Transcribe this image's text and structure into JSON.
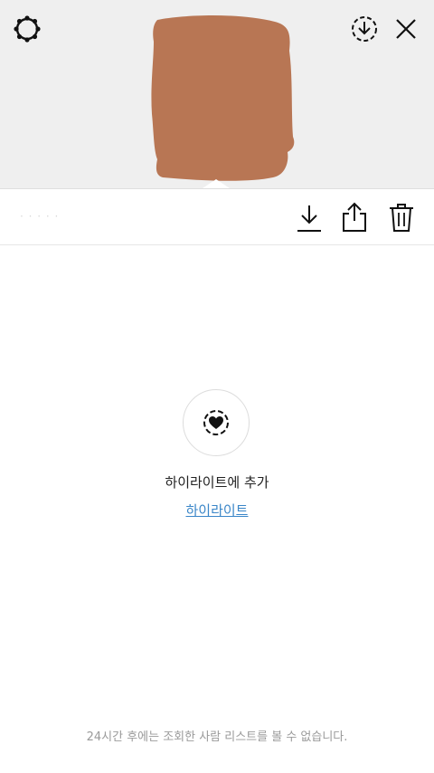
{
  "top_bar": {
    "settings_icon": "settings-icon",
    "save_story_icon": "download-circle-icon",
    "close_icon": "close-icon"
  },
  "story_thumbnail": {
    "color": "#b87654"
  },
  "action_bar": {
    "faded_label": "· · · · ·",
    "download_icon": "download-icon",
    "share_icon": "share-icon",
    "delete_icon": "trash-icon"
  },
  "highlight": {
    "title": "하이라이트에 추가",
    "link": "하이라이트"
  },
  "footer": {
    "note": "24시간 후에는 조회한 사람 리스트를 볼 수 없습니다."
  },
  "colors": {
    "link": "#3a86c8",
    "top_background": "#efefef",
    "footer_text": "#9a9a9a"
  }
}
